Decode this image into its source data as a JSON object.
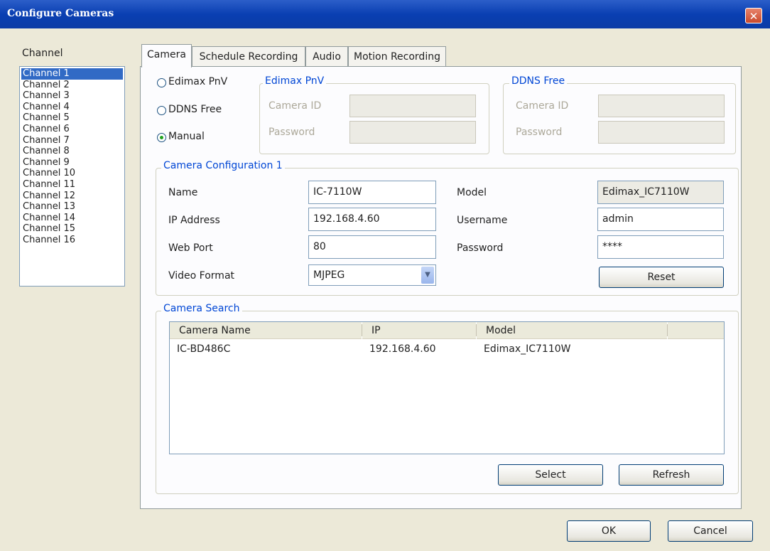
{
  "window": {
    "title": "Configure Cameras",
    "close_glyph": "✕"
  },
  "channel": {
    "label": "Channel",
    "items": [
      "Channel 1",
      "Channel 2",
      "Channel 3",
      "Channel 4",
      "Channel 5",
      "Channel 6",
      "Channel 7",
      "Channel 8",
      "Channel 9",
      "Channel 10",
      "Channel 11",
      "Channel 12",
      "Channel 13",
      "Channel 14",
      "Channel 15",
      "Channel 16"
    ],
    "selected": "Channel 1"
  },
  "tabs": [
    {
      "label": "Camera",
      "active": true
    },
    {
      "label": "Schedule Recording",
      "active": false
    },
    {
      "label": "Audio",
      "active": false
    },
    {
      "label": "Motion Recording",
      "active": false
    }
  ],
  "connection": {
    "options": [
      "Edimax PnV",
      "DDNS Free",
      "Manual"
    ],
    "selected": "Manual"
  },
  "edimax_pnv": {
    "title": "Edimax PnV",
    "camera_id_label": "Camera ID",
    "password_label": "Password",
    "camera_id": "",
    "password": ""
  },
  "ddns_free": {
    "title": "DDNS Free",
    "camera_id_label": "Camera ID",
    "password_label": "Password",
    "camera_id": "",
    "password": ""
  },
  "config": {
    "title": "Camera Configuration 1",
    "name_label": "Name",
    "name": "IC-7110W",
    "ip_label": "IP Address",
    "ip": "192.168.4.60",
    "port_label": "Web Port",
    "port": "80",
    "format_label": "Video Format",
    "format": "MJPEG",
    "model_label": "Model",
    "model": "Edimax_IC7110W",
    "username_label": "Username",
    "username": "admin",
    "password_label": "Password",
    "password": "****",
    "reset_label": "Reset"
  },
  "search": {
    "title": "Camera Search",
    "columns": [
      "Camera Name",
      "IP",
      "Model"
    ],
    "rows": [
      {
        "name": "IC-BD486C",
        "ip": "192.168.4.60",
        "model": "Edimax_IC7110W"
      }
    ],
    "select_label": "Select",
    "refresh_label": "Refresh"
  },
  "footer": {
    "ok_label": "OK",
    "cancel_label": "Cancel"
  },
  "colors": {
    "titlebar": "#0a3fb2",
    "selection": "#316ac5",
    "group_title": "#0046d5",
    "radio_dot": "#21a121"
  }
}
